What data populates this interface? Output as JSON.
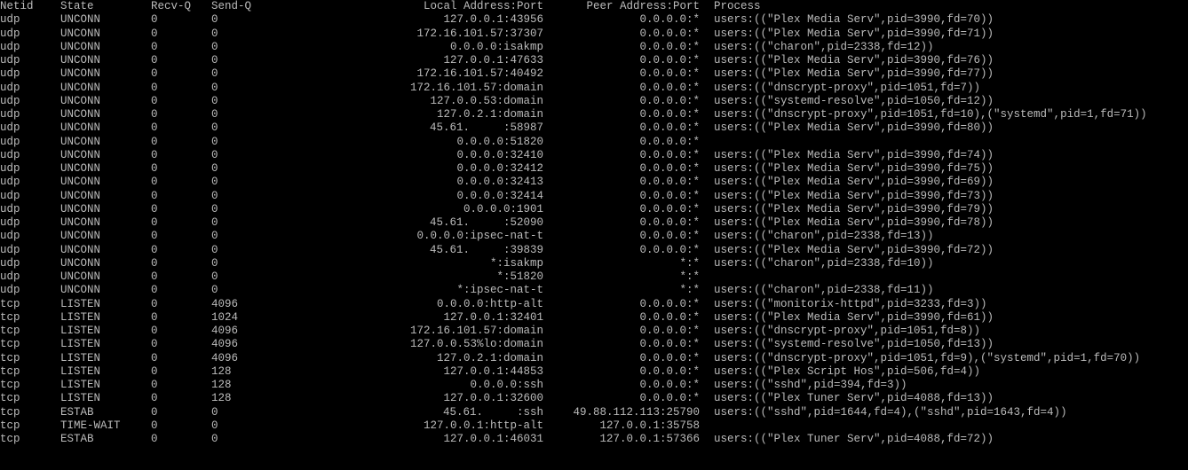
{
  "headers": {
    "netid": "Netid",
    "state": "State",
    "recvq": "Recv-Q",
    "sendq": "Send-Q",
    "local": "Local Address:Port",
    "peer": "Peer Address:Port",
    "process": "Process"
  },
  "rows": [
    {
      "netid": "udp",
      "state": "UNCONN",
      "recvq": "0",
      "sendq": "0",
      "local": "127.0.0.1:43956",
      "peer": "0.0.0.0:*",
      "proc": "users:((\"Plex Media Serv\",pid=3990,fd=70))"
    },
    {
      "netid": "udp",
      "state": "UNCONN",
      "recvq": "0",
      "sendq": "0",
      "local": "172.16.101.57:37307",
      "peer": "0.0.0.0:*",
      "proc": "users:((\"Plex Media Serv\",pid=3990,fd=71))"
    },
    {
      "netid": "udp",
      "state": "UNCONN",
      "recvq": "0",
      "sendq": "0",
      "local": "0.0.0.0:isakmp",
      "peer": "0.0.0.0:*",
      "proc": "users:((\"charon\",pid=2338,fd=12))"
    },
    {
      "netid": "udp",
      "state": "UNCONN",
      "recvq": "0",
      "sendq": "0",
      "local": "127.0.0.1:47633",
      "peer": "0.0.0.0:*",
      "proc": "users:((\"Plex Media Serv\",pid=3990,fd=76))"
    },
    {
      "netid": "udp",
      "state": "UNCONN",
      "recvq": "0",
      "sendq": "0",
      "local": "172.16.101.57:40492",
      "peer": "0.0.0.0:*",
      "proc": "users:((\"Plex Media Serv\",pid=3990,fd=77))"
    },
    {
      "netid": "udp",
      "state": "UNCONN",
      "recvq": "0",
      "sendq": "0",
      "local": "172.16.101.57:domain",
      "peer": "0.0.0.0:*",
      "proc": "users:((\"dnscrypt-proxy\",pid=1051,fd=7))"
    },
    {
      "netid": "udp",
      "state": "UNCONN",
      "recvq": "0",
      "sendq": "0",
      "local": "127.0.0.53:domain",
      "peer": "0.0.0.0:*",
      "proc": "users:((\"systemd-resolve\",pid=1050,fd=12))"
    },
    {
      "netid": "udp",
      "state": "UNCONN",
      "recvq": "0",
      "sendq": "0",
      "local": "127.0.2.1:domain",
      "peer": "0.0.0.0:*",
      "proc": "users:((\"dnscrypt-proxy\",pid=1051,fd=10),(\"systemd\",pid=1,fd=71))"
    },
    {
      "netid": "udp",
      "state": "UNCONN",
      "recvq": "0",
      "sendq": "0",
      "local_pre": "45.61.",
      "local_post": ":58987",
      "peer": "0.0.0.0:*",
      "proc": "users:((\"Plex Media Serv\",pid=3990,fd=80))"
    },
    {
      "netid": "udp",
      "state": "UNCONN",
      "recvq": "0",
      "sendq": "0",
      "local": "0.0.0.0:51820",
      "peer": "0.0.0.0:*",
      "proc": ""
    },
    {
      "netid": "udp",
      "state": "UNCONN",
      "recvq": "0",
      "sendq": "0",
      "local": "0.0.0.0:32410",
      "peer": "0.0.0.0:*",
      "proc": "users:((\"Plex Media Serv\",pid=3990,fd=74))"
    },
    {
      "netid": "udp",
      "state": "UNCONN",
      "recvq": "0",
      "sendq": "0",
      "local": "0.0.0.0:32412",
      "peer": "0.0.0.0:*",
      "proc": "users:((\"Plex Media Serv\",pid=3990,fd=75))"
    },
    {
      "netid": "udp",
      "state": "UNCONN",
      "recvq": "0",
      "sendq": "0",
      "local": "0.0.0.0:32413",
      "peer": "0.0.0.0:*",
      "proc": "users:((\"Plex Media Serv\",pid=3990,fd=69))"
    },
    {
      "netid": "udp",
      "state": "UNCONN",
      "recvq": "0",
      "sendq": "0",
      "local": "0.0.0.0:32414",
      "peer": "0.0.0.0:*",
      "proc": "users:((\"Plex Media Serv\",pid=3990,fd=73))"
    },
    {
      "netid": "udp",
      "state": "UNCONN",
      "recvq": "0",
      "sendq": "0",
      "local": "0.0.0.0:1901",
      "peer": "0.0.0.0:*",
      "proc": "users:((\"Plex Media Serv\",pid=3990,fd=79))"
    },
    {
      "netid": "udp",
      "state": "UNCONN",
      "recvq": "0",
      "sendq": "0",
      "local_pre": "45.61.",
      "local_post": ":52090",
      "peer": "0.0.0.0:*",
      "proc": "users:((\"Plex Media Serv\",pid=3990,fd=78))"
    },
    {
      "netid": "udp",
      "state": "UNCONN",
      "recvq": "0",
      "sendq": "0",
      "local": "0.0.0.0:ipsec-nat-t",
      "peer": "0.0.0.0:*",
      "proc": "users:((\"charon\",pid=2338,fd=13))"
    },
    {
      "netid": "udp",
      "state": "UNCONN",
      "recvq": "0",
      "sendq": "0",
      "local_pre": "45.61.",
      "local_post": ":39839",
      "peer": "0.0.0.0:*",
      "proc": "users:((\"Plex Media Serv\",pid=3990,fd=72))"
    },
    {
      "netid": "udp",
      "state": "UNCONN",
      "recvq": "0",
      "sendq": "0",
      "local": "*:isakmp",
      "peer": "*:*",
      "proc": "users:((\"charon\",pid=2338,fd=10))"
    },
    {
      "netid": "udp",
      "state": "UNCONN",
      "recvq": "0",
      "sendq": "0",
      "local": "*:51820",
      "peer": "*:*",
      "proc": ""
    },
    {
      "netid": "udp",
      "state": "UNCONN",
      "recvq": "0",
      "sendq": "0",
      "local": "*:ipsec-nat-t",
      "peer": "*:*",
      "proc": "users:((\"charon\",pid=2338,fd=11))"
    },
    {
      "netid": "tcp",
      "state": "LISTEN",
      "recvq": "0",
      "sendq": "4096",
      "local": "0.0.0.0:http-alt",
      "peer": "0.0.0.0:*",
      "proc": "users:((\"monitorix-httpd\",pid=3233,fd=3))"
    },
    {
      "netid": "tcp",
      "state": "LISTEN",
      "recvq": "0",
      "sendq": "1024",
      "local": "127.0.0.1:32401",
      "peer": "0.0.0.0:*",
      "proc": "users:((\"Plex Media Serv\",pid=3990,fd=61))"
    },
    {
      "netid": "tcp",
      "state": "LISTEN",
      "recvq": "0",
      "sendq": "4096",
      "local": "172.16.101.57:domain",
      "peer": "0.0.0.0:*",
      "proc": "users:((\"dnscrypt-proxy\",pid=1051,fd=8))"
    },
    {
      "netid": "tcp",
      "state": "LISTEN",
      "recvq": "0",
      "sendq": "4096",
      "local": "127.0.0.53%lo:domain",
      "peer": "0.0.0.0:*",
      "proc": "users:((\"systemd-resolve\",pid=1050,fd=13))"
    },
    {
      "netid": "tcp",
      "state": "LISTEN",
      "recvq": "0",
      "sendq": "4096",
      "local": "127.0.2.1:domain",
      "peer": "0.0.0.0:*",
      "proc": "users:((\"dnscrypt-proxy\",pid=1051,fd=9),(\"systemd\",pid=1,fd=70))"
    },
    {
      "netid": "tcp",
      "state": "LISTEN",
      "recvq": "0",
      "sendq": "128",
      "local": "127.0.0.1:44853",
      "peer": "0.0.0.0:*",
      "proc": "users:((\"Plex Script Hos\",pid=506,fd=4))"
    },
    {
      "netid": "tcp",
      "state": "LISTEN",
      "recvq": "0",
      "sendq": "128",
      "local": "0.0.0.0:ssh",
      "peer": "0.0.0.0:*",
      "proc": "users:((\"sshd\",pid=394,fd=3))"
    },
    {
      "netid": "tcp",
      "state": "LISTEN",
      "recvq": "0",
      "sendq": "128",
      "local": "127.0.0.1:32600",
      "peer": "0.0.0.0:*",
      "proc": "users:((\"Plex Tuner Serv\",pid=4088,fd=13))"
    },
    {
      "netid": "tcp",
      "state": "ESTAB",
      "recvq": "0",
      "sendq": "0",
      "local_pre": "45.61.",
      "local_post": ":ssh",
      "peer": "49.88.112.113:25790",
      "proc": "users:((\"sshd\",pid=1644,fd=4),(\"sshd\",pid=1643,fd=4))"
    },
    {
      "netid": "tcp",
      "state": "TIME-WAIT",
      "recvq": "0",
      "sendq": "0",
      "local": "127.0.0.1:http-alt",
      "peer": "127.0.0.1:35758",
      "proc": ""
    },
    {
      "netid": "tcp",
      "state": "ESTAB",
      "recvq": "0",
      "sendq": "0",
      "local": "127.0.0.1:46031",
      "peer": "127.0.0.1:57366",
      "proc": "users:((\"Plex Tuner Serv\",pid=4088,fd=72))"
    }
  ]
}
